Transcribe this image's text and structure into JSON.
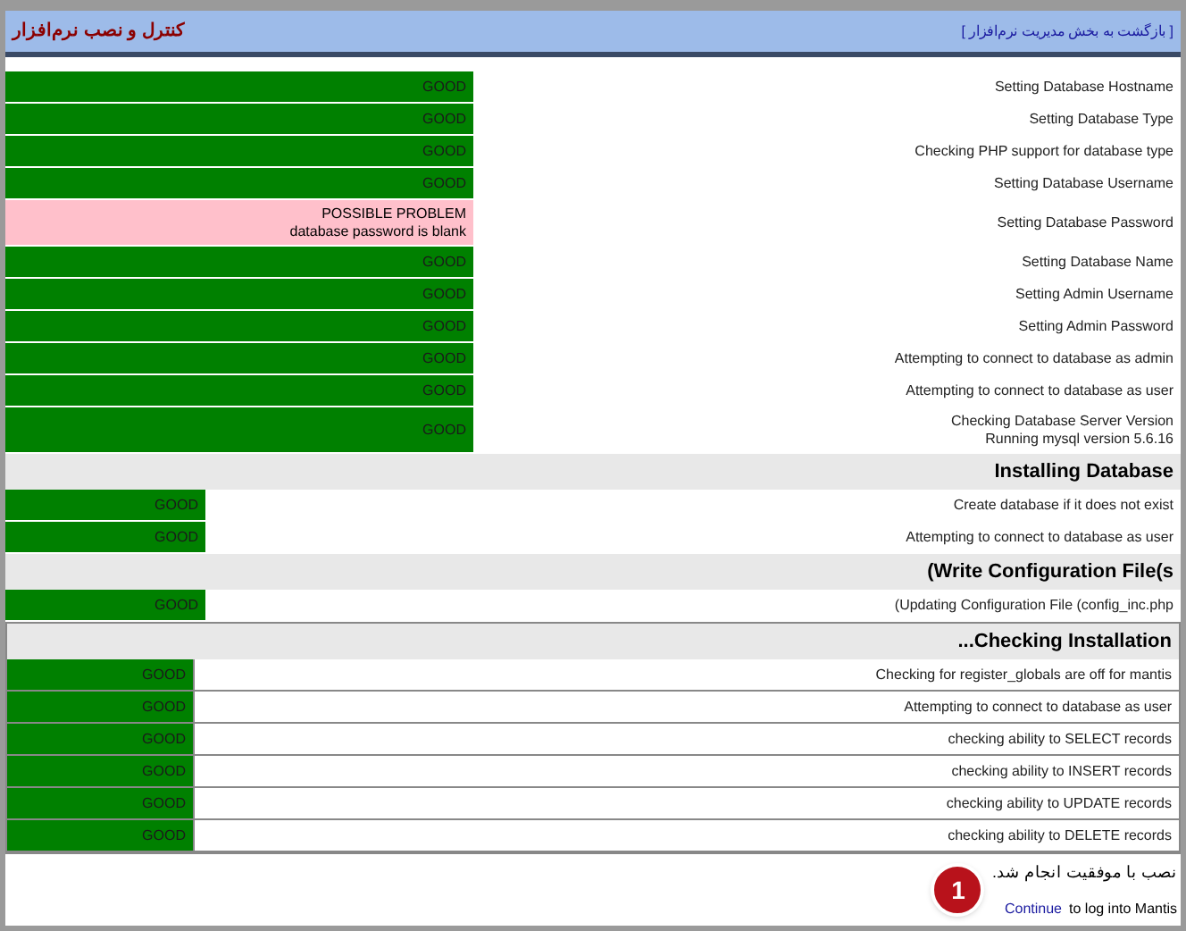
{
  "header": {
    "title": "کنترل و نصب نرم‌افزار",
    "back_link": "[ بازگشت به بخش مدیریت نرم‌افزار ]"
  },
  "sections": [
    {
      "kind": "wide",
      "rows": [
        {
          "label": [
            "Setting Database Hostname"
          ],
          "kind": "good",
          "result": [
            "GOOD"
          ]
        },
        {
          "label": [
            "Setting Database Type"
          ],
          "kind": "good",
          "result": [
            "GOOD"
          ]
        },
        {
          "label": [
            "Checking PHP support for database type"
          ],
          "kind": "good",
          "result": [
            "GOOD"
          ]
        },
        {
          "label": [
            "Setting Database Username"
          ],
          "kind": "good",
          "result": [
            "GOOD"
          ]
        },
        {
          "label": [
            "Setting Database Password"
          ],
          "kind": "problem",
          "result": [
            "POSSIBLE PROBLEM",
            "database password is blank"
          ]
        },
        {
          "label": [
            "Setting Database Name"
          ],
          "kind": "good",
          "result": [
            "GOOD"
          ]
        },
        {
          "label": [
            "Setting Admin Username"
          ],
          "kind": "good",
          "result": [
            "GOOD"
          ]
        },
        {
          "label": [
            "Setting Admin Password"
          ],
          "kind": "good",
          "result": [
            "GOOD"
          ]
        },
        {
          "label": [
            "Attempting to connect to database as admin"
          ],
          "kind": "good",
          "result": [
            "GOOD"
          ]
        },
        {
          "label": [
            "Attempting to connect to database as user"
          ],
          "kind": "good",
          "result": [
            "GOOD"
          ]
        },
        {
          "label": [
            "Checking Database Server Version",
            "Running mysql version 5.6.16"
          ],
          "kind": "good",
          "result": [
            "GOOD"
          ]
        }
      ]
    },
    {
      "title": "Installing Database",
      "kind": "narrow",
      "rows": [
        {
          "label": [
            "Create database if it does not exist"
          ],
          "kind": "good",
          "result": [
            "GOOD"
          ]
        },
        {
          "label": [
            "Attempting to connect to database as user"
          ],
          "kind": "good",
          "result": [
            "GOOD"
          ]
        }
      ]
    },
    {
      "title": "(Write Configuration File(s",
      "kind": "narrow",
      "rows": [
        {
          "label": [
            "(Updating Configuration File (config_inc.php"
          ],
          "kind": "good",
          "result": [
            "GOOD"
          ]
        }
      ]
    },
    {
      "title": "...Checking Installation",
      "kind": "bordered",
      "rows": [
        {
          "label": [
            "Checking for register_globals are off for mantis"
          ],
          "kind": "good",
          "result": [
            "GOOD"
          ]
        },
        {
          "label": [
            "Attempting to connect to database as user"
          ],
          "kind": "good",
          "result": [
            "GOOD"
          ]
        },
        {
          "label": [
            "checking ability to SELECT records"
          ],
          "kind": "good",
          "result": [
            "GOOD"
          ]
        },
        {
          "label": [
            "checking ability to INSERT records"
          ],
          "kind": "good",
          "result": [
            "GOOD"
          ]
        },
        {
          "label": [
            "checking ability to UPDATE records"
          ],
          "kind": "good",
          "result": [
            "GOOD"
          ]
        },
        {
          "label": [
            "checking ability to DELETE records"
          ],
          "kind": "good",
          "result": [
            "GOOD"
          ]
        }
      ]
    }
  ],
  "footer": {
    "message": "نصب با موفقیت انجام شد.",
    "link": "Continue",
    "link_suffix": "to log into Mantis",
    "badge": "1"
  }
}
